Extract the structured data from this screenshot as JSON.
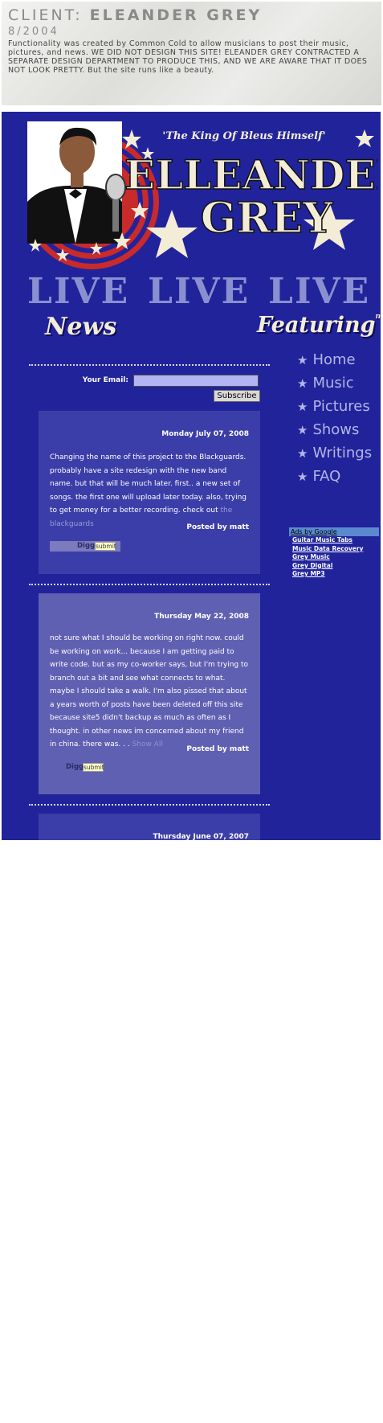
{
  "header": {
    "client_label": "CLIENT:",
    "client_name": "ELEANDER GREY",
    "date": "8/2004",
    "description": "Functionality was created by Common Cold to  allow musicians to post their music, pictures, and news.  WE DID NOT DESIGN THIS SITE! ELEANDER GREY CONTRACTED A SEPARATE DESIGN DEPARTMENT TO PRODUCE THIS, AND WE ARE AWARE THAT IT DOES NOT LOOK PRETTY. But the site runs like a beauty."
  },
  "banner": {
    "tagline": "'The King Of Bleus Himself'",
    "name_line1": "ELLEANDER",
    "name_line2": "GREY",
    "live_words": [
      "LIVE",
      "LIVE",
      "LIVE"
    ],
    "section_news": "News",
    "section_featuring": "Featuring",
    "featuring_prefix": "now"
  },
  "subscribe": {
    "email_label": "Your Email:",
    "email_value": "",
    "button_label": "Subscribe"
  },
  "posts": [
    {
      "date": "Monday July 07, 2008",
      "body": "Changing the name of this project to the Blackguards. probably have a site redesign with the new band name. but that will be much later. first.. a new set of songs. the first one will upload later today. also, trying to get money for a better recording. check out ",
      "link": "the blackguards",
      "posted_by": "Posted by matt",
      "digg_label": "Digg",
      "digg_button": "submit"
    },
    {
      "date": "Thursday May 22, 2008",
      "body": "not sure what I should be working on right now. could be working on work... because I am getting paid to write code. but as my co-worker says, but I'm trying to branch out a bit and see what connects to what. maybe I should take a walk. I'm also pissed that about a years worth of posts have been deleted off this site because site5 didn't backup as much as often as I thought. in other news im concerned about my friend in china. there was. . . ",
      "link": "Show All",
      "posted_by": "Posted by matt",
      "digg_label": "Digg",
      "digg_button": "submit"
    },
    {
      "date": "Thursday June 07, 2007"
    }
  ],
  "nav": {
    "items": [
      {
        "label": "Home",
        "icon": "star-icon"
      },
      {
        "label": "Music",
        "icon": "star-icon"
      },
      {
        "label": "Pictures",
        "icon": "star-icon"
      },
      {
        "label": "Shows",
        "icon": "star-icon"
      },
      {
        "label": "Writings",
        "icon": "star-icon"
      },
      {
        "label": "FAQ",
        "icon": "star-icon"
      }
    ]
  },
  "ads": {
    "heading": "Ads by Google",
    "links": [
      "Guitar Music Tabs",
      "Music Data Recovery",
      "Grey Music",
      "Grey Digital",
      "Grey MP3"
    ]
  },
  "colors": {
    "site_bg": "#21239b",
    "post_dark": "#3b3ea8",
    "post_light": "#6060b3",
    "cream": "#f3ecd6",
    "input_bg": "#b3b4f2",
    "ads_head": "#5b89d0"
  }
}
